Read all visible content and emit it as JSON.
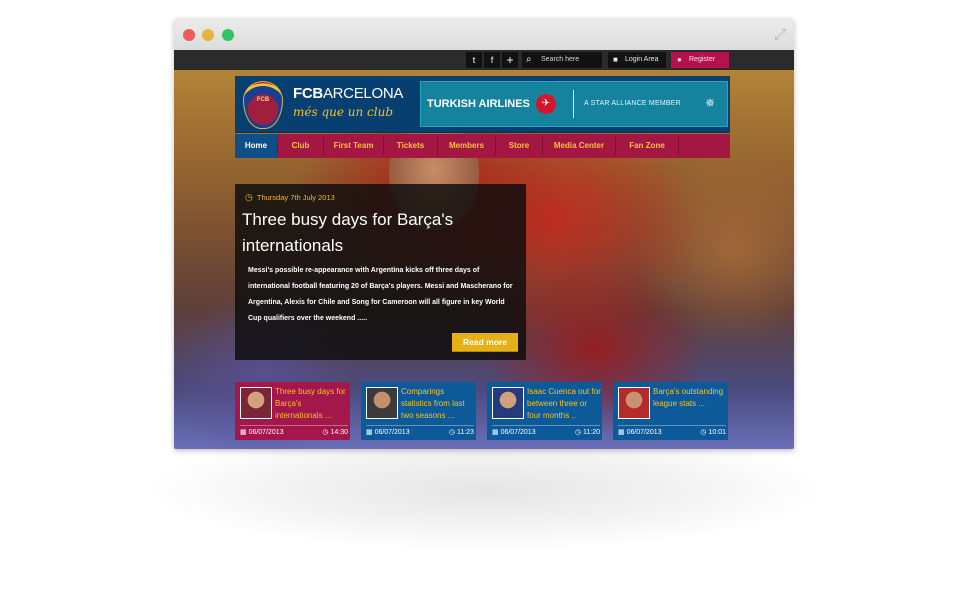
{
  "top_bar": {
    "social": [
      "twitter",
      "facebook",
      "plus"
    ],
    "search_placeholder": "Search here",
    "login_label": "Login Area",
    "register_label": "Register"
  },
  "header": {
    "brand_bold": "FCB",
    "brand_rest": "ARCELONA",
    "motto": "més que un club",
    "crest_text": "FCB",
    "sponsor_name": "TURKISH AIRLINES",
    "sponsor_alliance": "A STAR ALLIANCE MEMBER"
  },
  "nav": {
    "items": [
      "Home",
      "Club",
      "First Team",
      "Tickets",
      "Members",
      "Store",
      "Media Center",
      "Fan Zone"
    ],
    "active": "Home"
  },
  "feature": {
    "date": "Thursday 7th July 2013",
    "title": "Three busy days for Barça's internationals",
    "text": "Messi's possible re-appearance with Argentina kicks off three days of international football featuring 20 of Barça's players. Messi and Mascherano for Argentina, Alexis for Chile and Song for Cameroon will all figure in key World Cup qualifiers over the weekend .....",
    "button": "Read more"
  },
  "cards": [
    {
      "title": "Three busy days for Barça's internationals ...",
      "date": "06/07/2013",
      "time": "14:30",
      "color": "#a4174a"
    },
    {
      "title": "Comparings statistics from last two seasons ...",
      "date": "06/07/2013",
      "time": "11:23",
      "color": "#0d5a9a"
    },
    {
      "title": "Isaac Cuenca out for between three or four months ..",
      "date": "06/07/2013",
      "time": "11:20",
      "color": "#0d5a9a"
    },
    {
      "title": "Barça's outstanding league stats ...",
      "date": "06/07/2013",
      "time": "10:01",
      "color": "#0d5a9a"
    }
  ],
  "colors": {
    "accent_gold": "#f2c12e",
    "club_blue": "#073f71",
    "club_maroon": "#a41742",
    "sponsor_teal": "#15839d"
  }
}
